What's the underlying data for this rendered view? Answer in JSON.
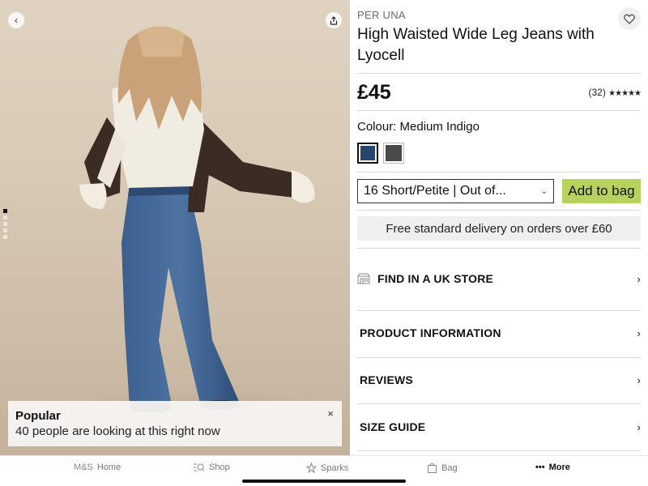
{
  "image_panel": {
    "back_icon": "chevron-left-icon",
    "share_icon": "share-icon",
    "gallery_dots": 5,
    "gallery_active_index": 0,
    "popular": {
      "title": "Popular",
      "text": "40 people are looking at this right now",
      "close_label": "×"
    }
  },
  "product": {
    "brand": "PER UNA",
    "title": "High Waisted Wide Leg Jeans with Lyocell",
    "price": "£45",
    "rating_count": "(32)",
    "rating_stars": "★★★★★",
    "colour_label": "Colour: Medium Indigo",
    "swatches": [
      {
        "name": "Medium Indigo",
        "color": "#24466e",
        "selected": true
      },
      {
        "name": "Grey",
        "color": "#4a4a4a",
        "selected": false
      }
    ],
    "size_value": "16 Short/Petite | Out of...",
    "add_to_bag": "Add to bag",
    "delivery": "Free standard delivery on orders over £60",
    "links": [
      {
        "label": "FIND IN A UK STORE",
        "icon": "store-icon"
      },
      {
        "label": "PRODUCT INFORMATION"
      },
      {
        "label": "REVIEWS"
      },
      {
        "label": "SIZE GUIDE"
      }
    ]
  },
  "tabbar": {
    "tabs": [
      {
        "prefix": "M&S",
        "label": "Home"
      },
      {
        "label": "Shop",
        "icon": "search-icon"
      },
      {
        "label": "Sparks",
        "icon": "sparks-icon"
      },
      {
        "label": "Bag",
        "icon": "bag-icon"
      },
      {
        "label": "More",
        "icon": "more-icon",
        "active": true
      }
    ]
  },
  "colors": {
    "accent_add_to_bag": "#b7d35c",
    "delivery_bg": "#efefef"
  }
}
